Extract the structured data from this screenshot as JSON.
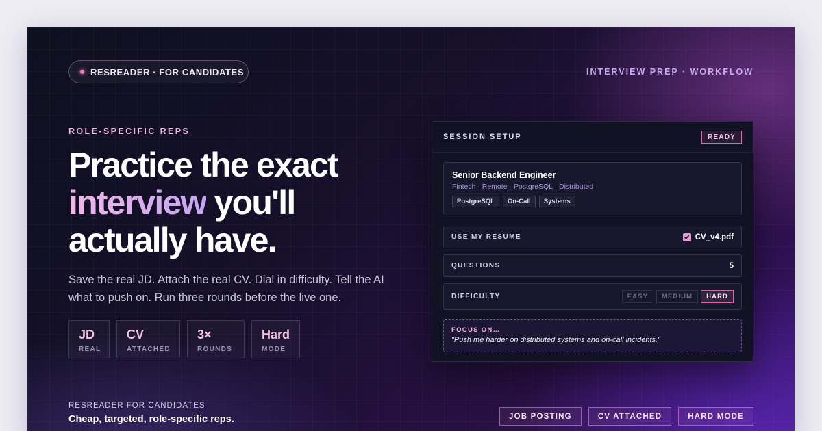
{
  "header": {
    "pill_label": "RESREADER · FOR CANDIDATES",
    "nav_label": "INTERVIEW PREP · WORKFLOW"
  },
  "hero": {
    "eyebrow": "ROLE-SPECIFIC REPS",
    "headline_part1": "Practice the exact",
    "headline_highlight": "interview",
    "headline_part2": "you'll",
    "headline_part3": "actually have.",
    "lead": "Save the real JD. Attach the real CV. Dial in difficulty. Tell the AI what to push on. Run three rounds before the live one.",
    "stats": [
      {
        "value": "JD",
        "label": "REAL"
      },
      {
        "value": "CV",
        "label": "ATTACHED"
      },
      {
        "value": "3×",
        "label": "ROUNDS"
      },
      {
        "value": "Hard",
        "label": "MODE"
      }
    ]
  },
  "panel": {
    "title": "SESSION SETUP",
    "status": "READY",
    "job": {
      "title": "Senior Backend Engineer",
      "meta": "Fintech · Remote · PostgreSQL · Distributed",
      "tags": [
        "PostgreSQL",
        "On-Call",
        "Systems"
      ]
    },
    "resume": {
      "label": "USE MY RESUME",
      "file": "CV_v4.pdf",
      "checked": true
    },
    "questions": {
      "label": "QUESTIONS",
      "value": "5"
    },
    "difficulty": {
      "label": "DIFFICULTY",
      "options": [
        "EASY",
        "MEDIUM",
        "HARD"
      ],
      "selected": "HARD"
    },
    "focus": {
      "label": "FOCUS ON…",
      "text": "\"Push me harder on distributed systems and on-call incidents.\""
    }
  },
  "footer": {
    "label": "RESREADER FOR CANDIDATES",
    "subtitle": "Cheap, targeted, role-specific reps.",
    "tags": [
      "JOB POSTING",
      "CV ATTACHED",
      "HARD MODE"
    ]
  },
  "colors": {
    "accent_pink": "#f07ab8",
    "accent_lavender": "#c4a6f2",
    "panel_bg": "#121225"
  }
}
